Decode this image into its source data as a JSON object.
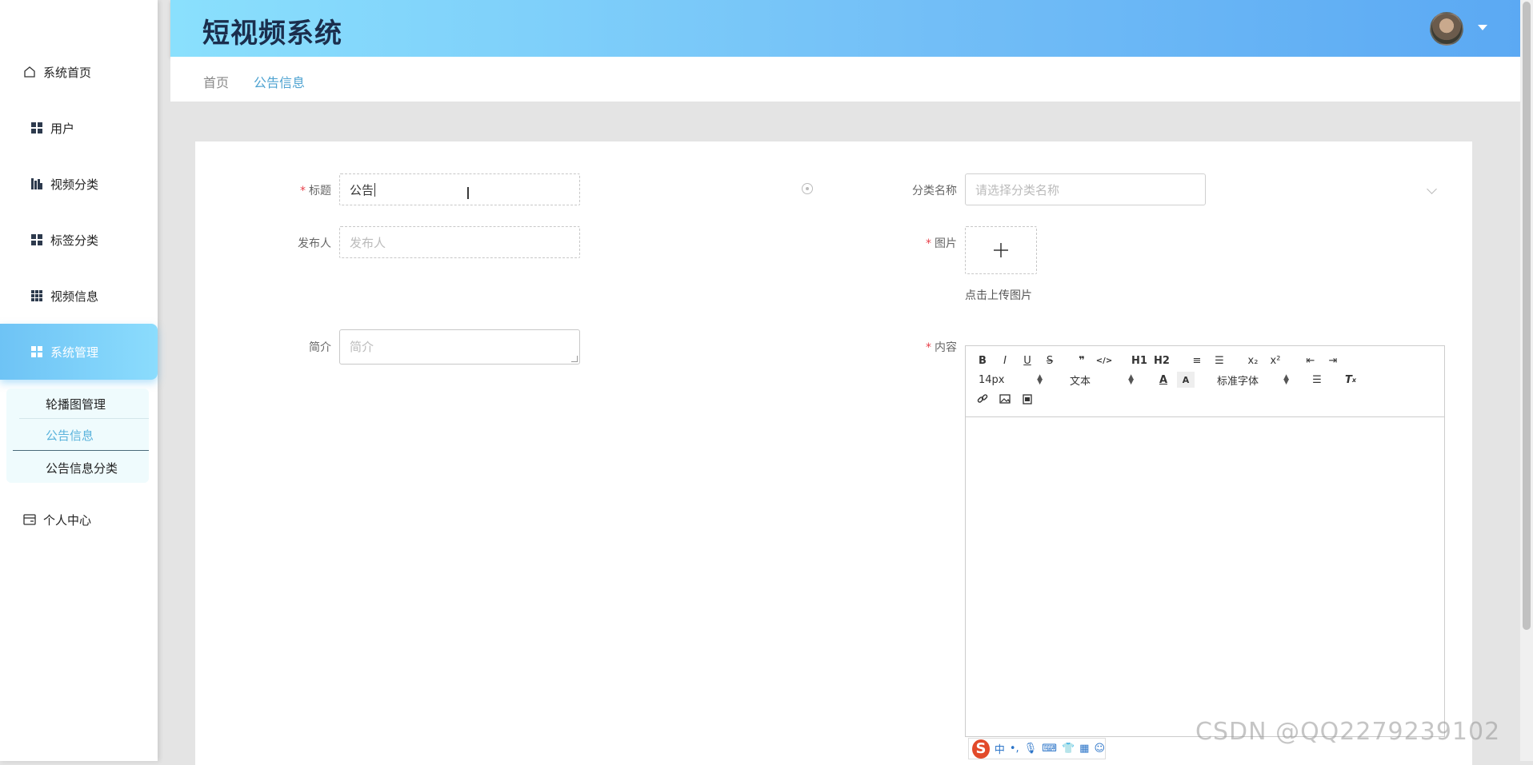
{
  "app": {
    "title": "短视频系统"
  },
  "sidebar": {
    "items": [
      {
        "label": "系统首页",
        "icon": "home-icon"
      },
      {
        "label": "用户",
        "icon": "grid-icon"
      },
      {
        "label": "视频分类",
        "icon": "chart-icon"
      },
      {
        "label": "标签分类",
        "icon": "grid-icon"
      },
      {
        "label": "视频信息",
        "icon": "apps-icon"
      },
      {
        "label": "系统管理",
        "icon": "grid-icon"
      },
      {
        "label": "个人中心",
        "icon": "card-icon"
      }
    ],
    "submenu": [
      {
        "label": "轮播图管理"
      },
      {
        "label": "公告信息"
      },
      {
        "label": "公告信息分类"
      }
    ]
  },
  "breadcrumb": {
    "home": "首页",
    "current": "公告信息"
  },
  "form": {
    "title": {
      "label": "标题",
      "value": "公告"
    },
    "category": {
      "label": "分类名称",
      "placeholder": "请选择分类名称"
    },
    "publisher": {
      "label": "发布人",
      "placeholder": "发布人"
    },
    "image": {
      "label": "图片",
      "hint": "点击上传图片"
    },
    "summary": {
      "label": "简介",
      "placeholder": "简介"
    },
    "content": {
      "label": "内容"
    }
  },
  "editor": {
    "buttons": [
      "B",
      "I",
      "U",
      "S",
      "❞",
      "</>",
      "H1",
      "H2",
      "≡",
      "☰",
      "x₂",
      "x²",
      "⇤",
      "⇥"
    ],
    "font_size": "14px",
    "block_type": "文本",
    "font_family": "标准字体"
  },
  "ime": {
    "mode": "中"
  },
  "watermark": "CSDN @QQ2279239102"
}
